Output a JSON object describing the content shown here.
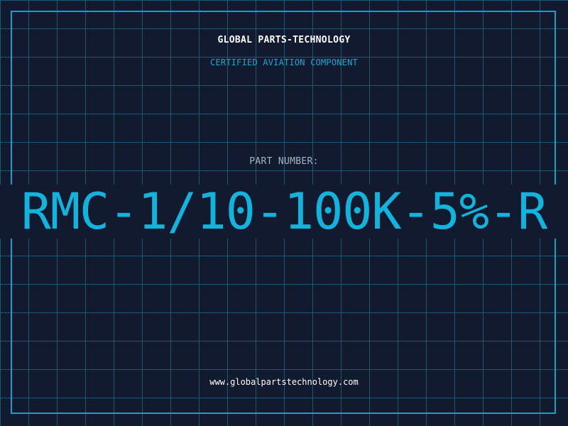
{
  "header": {
    "brand": "GLOBAL PARTS-TECHNOLOGY",
    "tagline": "CERTIFIED AVIATION COMPONENT"
  },
  "part": {
    "label": "PART NUMBER:",
    "number": "RMC-1/10-100K-5%-R"
  },
  "footer": {
    "url": "www.globalpartstechnology.com"
  },
  "colors": {
    "background": "#111a2e",
    "grid": "#1f6e8a",
    "accent": "#12b3dd",
    "label": "#a7b3c4",
    "text": "#ffffff"
  }
}
